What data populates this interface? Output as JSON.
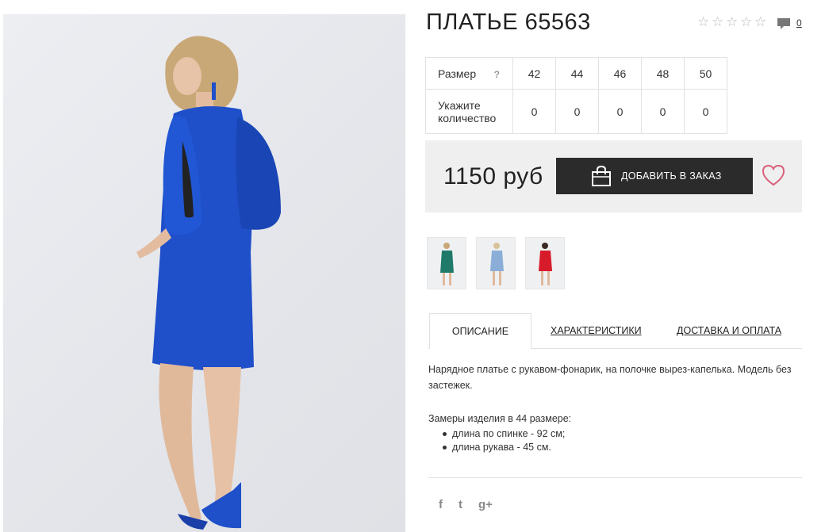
{
  "product": {
    "title": "ПЛАТЬЕ 65563",
    "comment_count": "0",
    "rating_stars": 0
  },
  "sizes": {
    "size_label": "Размер",
    "help": "?",
    "qty_label": "Укажите количество",
    "values": [
      "42",
      "44",
      "46",
      "48",
      "50"
    ],
    "quantities": [
      "0",
      "0",
      "0",
      "0",
      "0"
    ]
  },
  "purchase": {
    "price": "1150 руб",
    "add_button": "ДОБАВИТЬ В ЗАКАЗ"
  },
  "thumbnails": [
    {
      "color": "#1f7a6a",
      "alt": "green"
    },
    {
      "color": "#8aaed8",
      "alt": "light-blue"
    },
    {
      "color": "#d81b2a",
      "alt": "red"
    }
  ],
  "tabs": {
    "description": "ОПИСАНИЕ",
    "characteristics": "ХАРАКТЕРИСТИКИ",
    "delivery": "ДОСТАВКА И ОПЛАТА"
  },
  "description": {
    "text": "Нарядное платье с рукавом-фонарик, на полочке вырез-капелька. Модель без застежек.",
    "measures_title": "Замеры изделия в 44 размере:",
    "measures": [
      "длина по спинке - 92 см;",
      "длина рукава - 45 см."
    ]
  },
  "social": {
    "facebook": "f",
    "twitter": "t",
    "googleplus": "g+"
  },
  "colors": {
    "dress_blue": "#1f4fc9",
    "button_bg": "#2b2b2b",
    "heart": "#d9607a"
  }
}
